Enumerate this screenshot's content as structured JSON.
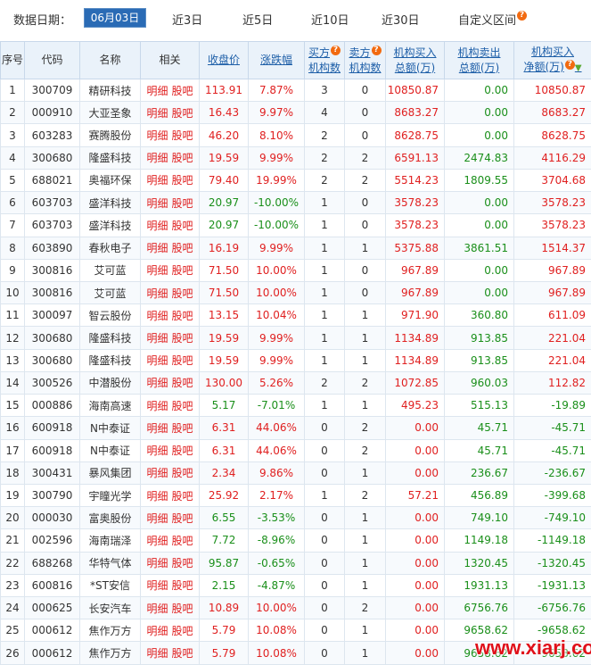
{
  "filter": {
    "label": "数据日期：",
    "date": "06月03日",
    "links": [
      "近3日",
      "近5日",
      "近10日",
      "近30日",
      "自定义区间"
    ]
  },
  "headers": [
    "序号",
    "代码",
    "名称",
    "相关",
    "收盘价",
    "涨跌幅",
    "买方机构数",
    "卖方机构数",
    "机构买入总额(万)",
    "机构卖出总额(万)",
    "机构买入净额(万)"
  ],
  "header_lines": [
    [
      "序号"
    ],
    [
      "代码"
    ],
    [
      "名称"
    ],
    [
      "相关"
    ],
    [
      "收盘价"
    ],
    [
      "涨跌幅"
    ],
    [
      "买方",
      "机构数"
    ],
    [
      "卖方",
      "机构数"
    ],
    [
      "机构买入",
      "总额(万)"
    ],
    [
      "机构卖出",
      "总额(万)"
    ],
    [
      "机构买入",
      "净额(万)"
    ]
  ],
  "related": [
    "明细",
    "股吧"
  ],
  "rows": [
    [
      "1",
      "300709",
      "精研科技",
      "113.91",
      "7.87%",
      "3",
      "0",
      "10850.87",
      "0.00",
      "10850.87"
    ],
    [
      "2",
      "000910",
      "大亚圣象",
      "16.43",
      "9.97%",
      "4",
      "0",
      "8683.27",
      "0.00",
      "8683.27"
    ],
    [
      "3",
      "603283",
      "赛腾股份",
      "46.20",
      "8.10%",
      "2",
      "0",
      "8628.75",
      "0.00",
      "8628.75"
    ],
    [
      "4",
      "300680",
      "隆盛科技",
      "19.59",
      "9.99%",
      "2",
      "2",
      "6591.13",
      "2474.83",
      "4116.29"
    ],
    [
      "5",
      "688021",
      "奥福环保",
      "79.40",
      "19.99%",
      "2",
      "2",
      "5514.23",
      "1809.55",
      "3704.68"
    ],
    [
      "6",
      "603703",
      "盛洋科技",
      "20.97",
      "-10.00%",
      "1",
      "0",
      "3578.23",
      "0.00",
      "3578.23"
    ],
    [
      "7",
      "603703",
      "盛洋科技",
      "20.97",
      "-10.00%",
      "1",
      "0",
      "3578.23",
      "0.00",
      "3578.23"
    ],
    [
      "8",
      "603890",
      "春秋电子",
      "16.19",
      "9.99%",
      "1",
      "1",
      "5375.88",
      "3861.51",
      "1514.37"
    ],
    [
      "9",
      "300816",
      "艾可蓝",
      "71.50",
      "10.00%",
      "1",
      "0",
      "967.89",
      "0.00",
      "967.89"
    ],
    [
      "10",
      "300816",
      "艾可蓝",
      "71.50",
      "10.00%",
      "1",
      "0",
      "967.89",
      "0.00",
      "967.89"
    ],
    [
      "11",
      "300097",
      "智云股份",
      "13.15",
      "10.04%",
      "1",
      "1",
      "971.90",
      "360.80",
      "611.09"
    ],
    [
      "12",
      "300680",
      "隆盛科技",
      "19.59",
      "9.99%",
      "1",
      "1",
      "1134.89",
      "913.85",
      "221.04"
    ],
    [
      "13",
      "300680",
      "隆盛科技",
      "19.59",
      "9.99%",
      "1",
      "1",
      "1134.89",
      "913.85",
      "221.04"
    ],
    [
      "14",
      "300526",
      "中潜股份",
      "130.00",
      "5.26%",
      "2",
      "2",
      "1072.85",
      "960.03",
      "112.82"
    ],
    [
      "15",
      "000886",
      "海南高速",
      "5.17",
      "-7.01%",
      "1",
      "1",
      "495.23",
      "515.13",
      "-19.89"
    ],
    [
      "16",
      "600918",
      "N中泰证",
      "6.31",
      "44.06%",
      "0",
      "2",
      "0.00",
      "45.71",
      "-45.71"
    ],
    [
      "17",
      "600918",
      "N中泰证",
      "6.31",
      "44.06%",
      "0",
      "2",
      "0.00",
      "45.71",
      "-45.71"
    ],
    [
      "18",
      "300431",
      "暴风集团",
      "2.34",
      "9.86%",
      "0",
      "1",
      "0.00",
      "236.67",
      "-236.67"
    ],
    [
      "19",
      "300790",
      "宇瞳光学",
      "25.92",
      "2.17%",
      "1",
      "2",
      "57.21",
      "456.89",
      "-399.68"
    ],
    [
      "20",
      "000030",
      "富奥股份",
      "6.55",
      "-3.53%",
      "0",
      "1",
      "0.00",
      "749.10",
      "-749.10"
    ],
    [
      "21",
      "002596",
      "海南瑞泽",
      "7.72",
      "-8.96%",
      "0",
      "1",
      "0.00",
      "1149.18",
      "-1149.18"
    ],
    [
      "22",
      "688268",
      "华特气体",
      "95.87",
      "-0.65%",
      "0",
      "1",
      "0.00",
      "1320.45",
      "-1320.45"
    ],
    [
      "23",
      "600816",
      "*ST安信",
      "2.15",
      "-4.87%",
      "0",
      "1",
      "0.00",
      "1931.13",
      "-1931.13"
    ],
    [
      "24",
      "000625",
      "长安汽车",
      "10.89",
      "10.00%",
      "0",
      "2",
      "0.00",
      "6756.76",
      "-6756.76"
    ],
    [
      "25",
      "000612",
      "焦作万方",
      "5.79",
      "10.08%",
      "0",
      "1",
      "0.00",
      "9658.62",
      "-9658.62"
    ],
    [
      "26",
      "000612",
      "焦作万方",
      "5.79",
      "10.08%",
      "0",
      "1",
      "0.00",
      "9658.62",
      "-9658.62"
    ]
  ],
  "watermark": "www.xiarj.com",
  "colors": {
    "up": "#e02020",
    "down": "#1a8f1a",
    "header_bg": "#eaf2fa",
    "date_bg": "#2a6bb5",
    "help_icon": "#f26a10"
  },
  "sort_icon": "sort-down-arrow-icon"
}
